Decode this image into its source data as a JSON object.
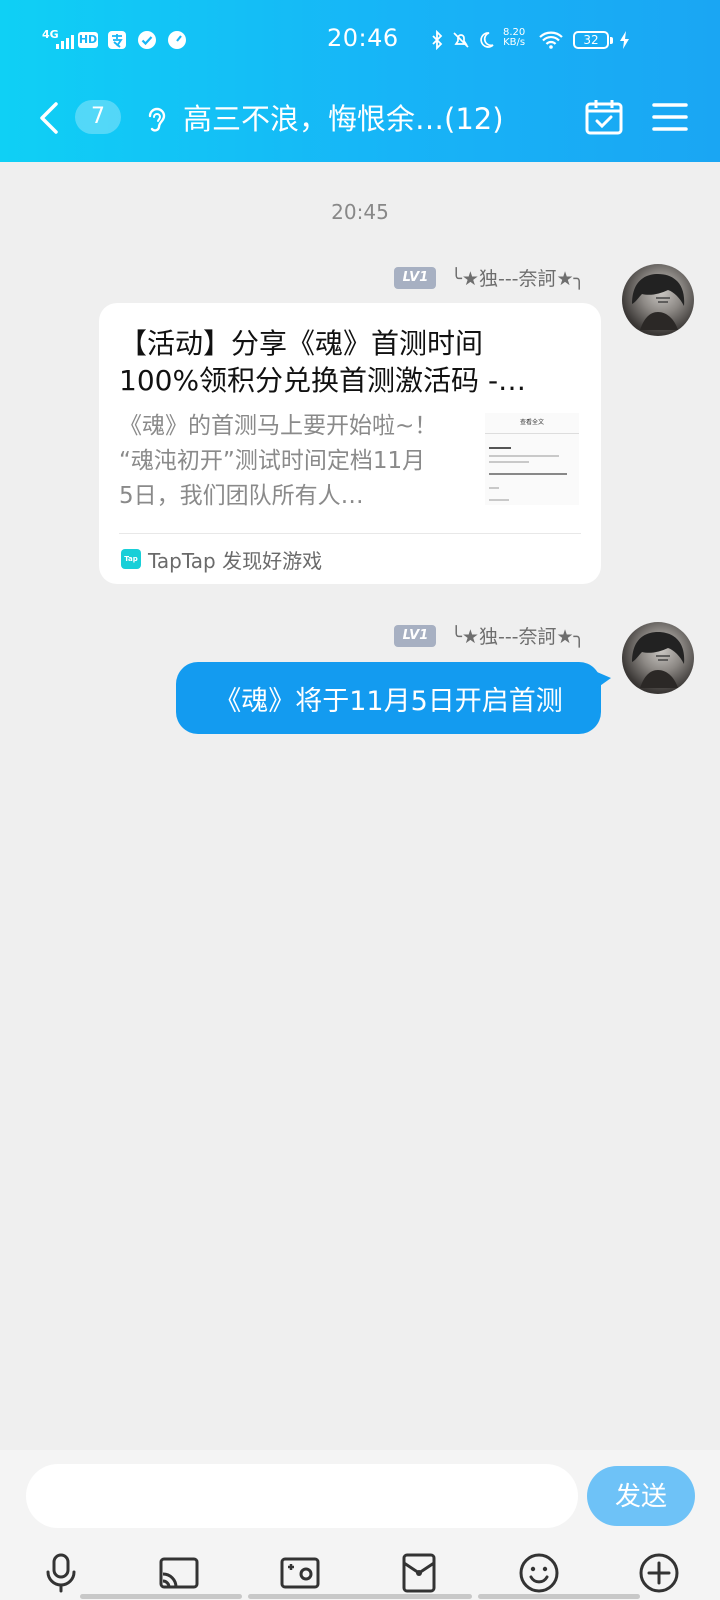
{
  "status_bar": {
    "network": "4G",
    "hd": "HD",
    "time": "20:46",
    "net_speed_value": "8.20",
    "net_speed_unit": "KB/s",
    "battery": "32"
  },
  "header": {
    "unread_count": "7",
    "title": "高三不浪，悔恨余…(12)"
  },
  "chat": {
    "timestamp": "20:45",
    "messages": [
      {
        "level": "LV1",
        "nickname": "╰★独---奈訶★╮",
        "card": {
          "title_line1": "【活动】分享《魂》首测时间",
          "title_line2": "100%领积分兑换首测激活码 -…",
          "desc_line1": "《魂》的首测马上要开始啦~！",
          "desc_line2": "“魂沌初开”测试时间定档11月",
          "desc_line3": "5日，我们团队所有人…",
          "thumb_heading": "查看全文",
          "source_logo": "Tap",
          "source": "TapTap 发现好游戏"
        }
      },
      {
        "level": "LV1",
        "nickname": "╰★独---奈訶★╮",
        "text": "《魂》将于11月5日开启首测"
      }
    ]
  },
  "input": {
    "placeholder": "",
    "send_label": "发送"
  },
  "toolbar": [
    "microphone-icon",
    "cast-icon",
    "photo-icon",
    "red-packet-icon",
    "emoji-icon",
    "plus-icon"
  ],
  "colors": {
    "header_start": "#0fd0f5",
    "header_end": "#1aa6f3",
    "bubble": "#139bf0",
    "send_button": "#6ec2f7",
    "background": "#efefef"
  }
}
